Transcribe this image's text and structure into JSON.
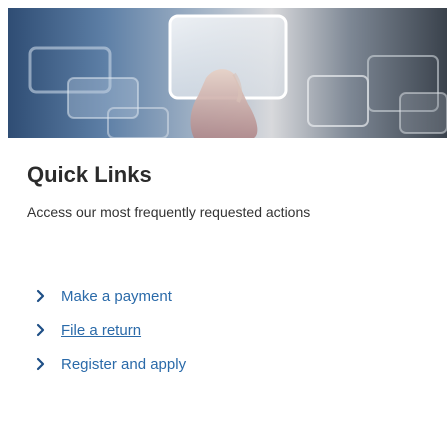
{
  "hero": {
    "image_icon": "hand-touching-screen-image"
  },
  "quick_links": {
    "title": "Quick Links",
    "subtitle": "Access our most frequently requested actions",
    "items": [
      {
        "label": "Make a payment",
        "icon": "chevron-right-icon",
        "underlined": false
      },
      {
        "label": "File a return",
        "icon": "chevron-right-icon",
        "underlined": true
      },
      {
        "label": "Register and apply",
        "icon": "chevron-right-icon",
        "underlined": false
      }
    ]
  },
  "colors": {
    "link": "#2a6aa9",
    "title": "#2b2b2b",
    "chevron": "#1f4f86"
  }
}
